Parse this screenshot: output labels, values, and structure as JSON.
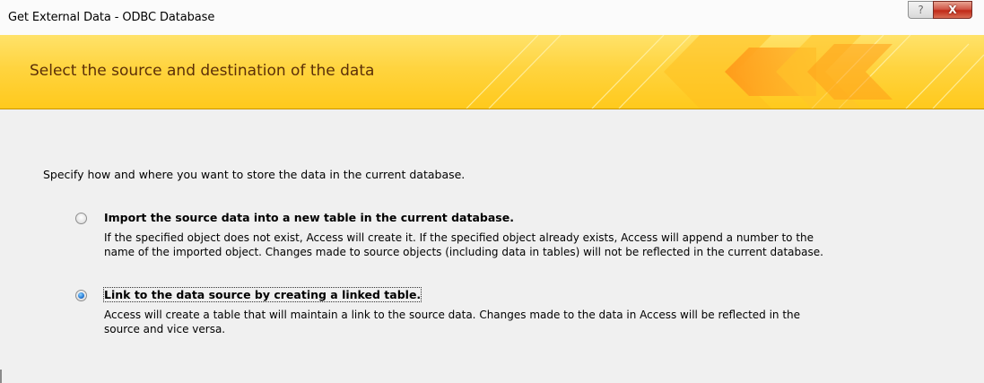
{
  "window": {
    "title": "Get External Data - ODBC Database",
    "help_glyph": "?",
    "close_glyph": "X"
  },
  "banner": {
    "title": "Select the source and destination of the data"
  },
  "content": {
    "instruction": "Specify how and where you want to store the data in the current database.",
    "options": [
      {
        "label": "Import the source data into a new table in the current database.",
        "selected": false,
        "description_lines": [
          "If the specified object does not exist, Access will create it. If the specified object already exists, Access will append a number to the",
          "name of the imported object. Changes made to source objects (including data in tables) will not be reflected in the current database."
        ]
      },
      {
        "label": "Link to the data source by creating a linked table.",
        "selected": true,
        "description_lines": [
          "Access will create a table that will maintain a link to the source data. Changes made to the data in Access will be reflected in the",
          "source and vice versa."
        ]
      }
    ]
  },
  "colors": {
    "banner_gold": "#ffd43f",
    "banner_text": "#5b2f08",
    "close_red": "#c12a18",
    "radio_blue": "#2b7fd8"
  }
}
